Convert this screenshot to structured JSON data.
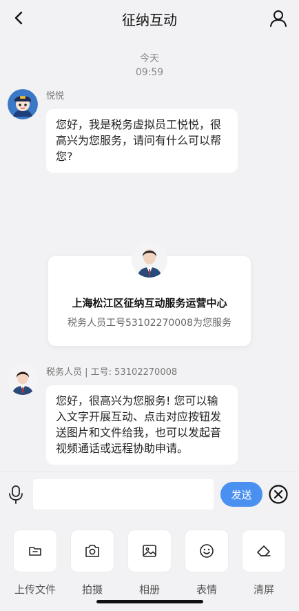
{
  "header": {
    "title": "征纳互动"
  },
  "chat": {
    "day": "今天",
    "time": "09:59",
    "messages": [
      {
        "sender": "悦悦",
        "text": "您好，我是税务虚拟员工悦悦，很高兴为您服务，请问有什么可以帮您?"
      },
      {
        "sender": "税务人员 | 工号: 53102270008",
        "text": "您好，很高兴为您服务! 您可以输入文字开展互动、点击对应按钮发送图片和文件给我，也可以发起音视频通话或远程协助申请。"
      }
    ]
  },
  "card": {
    "title": "上海松江区征纳互动服务运营中心",
    "subtitle": "税务人员工号53102270008为您服务"
  },
  "input": {
    "value": "",
    "placeholder": "",
    "send_label": "发送"
  },
  "toolbar": {
    "items": [
      {
        "label": "上传文件",
        "icon": "folder-icon"
      },
      {
        "label": "拍摄",
        "icon": "camera-icon"
      },
      {
        "label": "相册",
        "icon": "image-icon"
      },
      {
        "label": "表情",
        "icon": "smiley-icon"
      },
      {
        "label": "清屏",
        "icon": "eraser-icon"
      }
    ]
  },
  "colors": {
    "accent": "#4a90f0",
    "background": "#f2f2f4",
    "bubble": "#ffffff"
  }
}
